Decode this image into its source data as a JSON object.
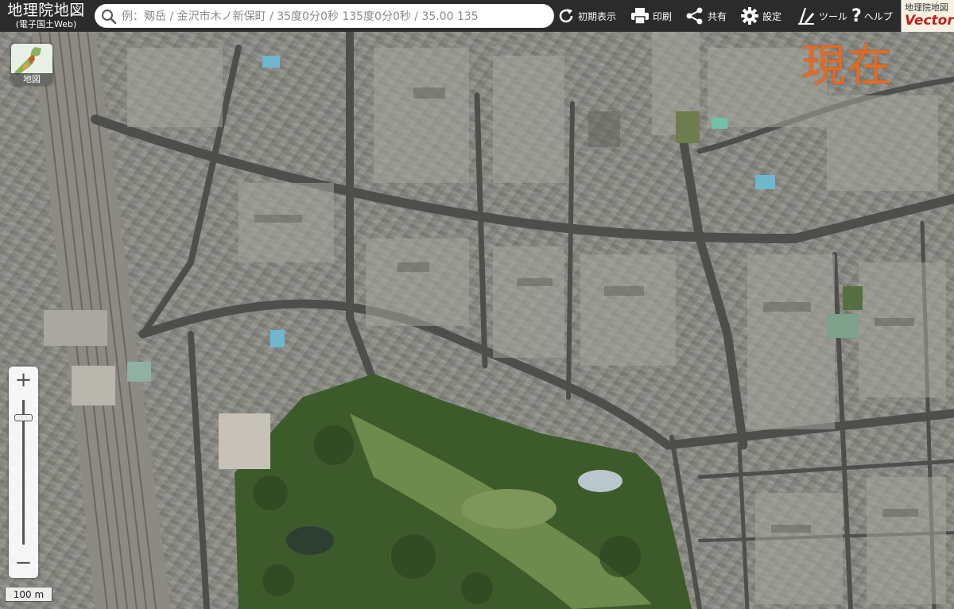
{
  "toolbar": {
    "brand_title": "地理院地図",
    "brand_subtitle": "(電子国土Web)",
    "search_placeholder": "例：剱岳 / 金沢市木ノ新保町 / 35度0分0秒 135度0分0秒 / 35.00 135",
    "reset_label": "初期表示",
    "print_label": "印刷",
    "share_label": "共有",
    "settings_label": "設定",
    "tools_label": "ツール",
    "help_label": "ヘルプ",
    "vector_top": "地理院地図",
    "vector_bottom": "Vector"
  },
  "map": {
    "basemap_label": "地図",
    "era_label": "現在",
    "scale_label": "100 m",
    "zoom_in": "+",
    "zoom_out": "−",
    "zoom_level_fraction": 0.88
  },
  "colors": {
    "toolbar_bg": "#2b2b2b",
    "era_label": "#e8691e",
    "vector_red": "#c0201c",
    "park_green": "#3d5a2a"
  },
  "icons": [
    "search-icon",
    "reset-icon",
    "print-icon",
    "share-icon",
    "gear-icon",
    "tools-icon",
    "help-icon"
  ]
}
